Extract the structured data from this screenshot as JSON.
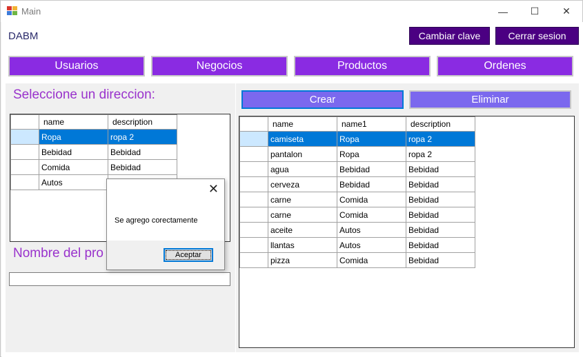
{
  "window": {
    "title": "Main",
    "minimize": "—",
    "maximize": "☐",
    "close": "✕"
  },
  "header": {
    "brand": "DABM",
    "change_password": "Cambiar clave",
    "logout": "Cerrar sesion"
  },
  "nav": {
    "users": "Usuarios",
    "businesses": "Negocios",
    "products": "Productos",
    "orders": "Ordenes"
  },
  "left": {
    "select_label": "Seleccione un direccion:",
    "product_name_label": "Nombre del pro",
    "product_name_value": "",
    "columns": [
      "name",
      "description"
    ],
    "rows": [
      {
        "name": "Ropa",
        "description": "ropa 2",
        "selected": true
      },
      {
        "name": "Bebidad",
        "description": "Bebidad",
        "selected": false
      },
      {
        "name": "Comida",
        "description": "Bebidad",
        "selected": false
      },
      {
        "name": "Autos",
        "description": "Bebidad",
        "selected": false
      }
    ]
  },
  "right": {
    "create": "Crear",
    "delete": "Eliminar",
    "columns": [
      "name",
      "name1",
      "description"
    ],
    "rows": [
      {
        "name": "camiseta",
        "name1": "Ropa",
        "description": "ropa 2",
        "selected": true
      },
      {
        "name": "pantalon",
        "name1": "Ropa",
        "description": "ropa 2",
        "selected": false
      },
      {
        "name": "agua",
        "name1": "Bebidad",
        "description": "Bebidad",
        "selected": false
      },
      {
        "name": "cerveza",
        "name1": "Bebidad",
        "description": "Bebidad",
        "selected": false
      },
      {
        "name": "carne",
        "name1": "Comida",
        "description": "Bebidad",
        "selected": false
      },
      {
        "name": "carne",
        "name1": "Comida",
        "description": "Bebidad",
        "selected": false
      },
      {
        "name": "aceite",
        "name1": "Autos",
        "description": "Bebidad",
        "selected": false
      },
      {
        "name": "llantas",
        "name1": "Autos",
        "description": "Bebidad",
        "selected": false
      },
      {
        "name": "pizza",
        "name1": "Comida",
        "description": "Bebidad",
        "selected": false
      }
    ]
  },
  "dialog": {
    "message": "Se agrego corectamente",
    "ok": "Aceptar",
    "close": "✕"
  },
  "colors": {
    "nav_purple": "#8a2be2",
    "dark_purple": "#4b0082",
    "action_purple": "#7b68ee",
    "label_purple": "#9932cc",
    "selection_blue": "#0078d7"
  }
}
